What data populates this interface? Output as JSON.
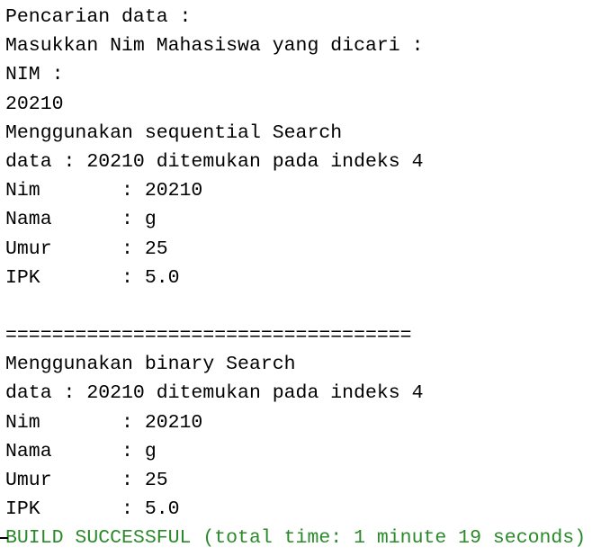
{
  "console": {
    "lines": [
      "Pencarian data :",
      "Masukkan Nim Mahasiswa yang dicari :",
      "NIM :",
      "20210",
      "Menggunakan sequential Search",
      "data : 20210 ditemukan pada indeks 4",
      "Nim       : 20210",
      "Nama      : g",
      "Umur      : 25",
      "IPK       : 5.0",
      "",
      "===================================",
      "Menggunakan binary Search",
      "data : 20210 ditemukan pada indeks 4",
      "Nim       : 20210",
      "Nama      : g",
      "Umur      : 25",
      "IPK       : 5.0",
      "BUILD SUCCESSFUL (total time: 1 minute 19 seconds)"
    ]
  },
  "colors": {
    "text": "#000000",
    "success": "#2a8a2a",
    "background": "#ffffff"
  }
}
